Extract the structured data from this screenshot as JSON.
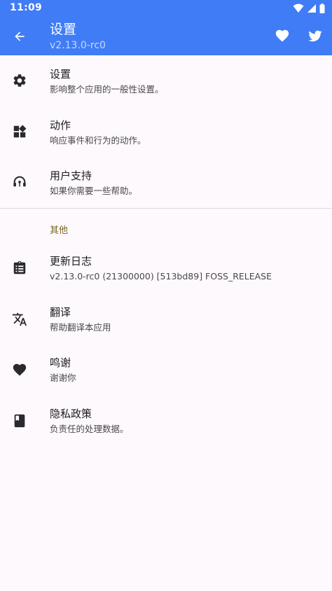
{
  "status_bar": {
    "time": "11:09"
  },
  "app_bar": {
    "title": "设置",
    "subtitle": "v2.13.0-rc0",
    "actions": [
      "heart-icon",
      "twitter-icon"
    ],
    "background_color": "#3f7cf6"
  },
  "items": [
    {
      "icon": "gear-icon",
      "title": "设置",
      "summary": "影响整个应用的一般性设置。"
    },
    {
      "icon": "widgets-icon",
      "title": "动作",
      "summary": "响应事件和行为的动作。"
    },
    {
      "icon": "support-headset-icon",
      "title": "用户支持",
      "summary": "如果你需要一些帮助。"
    }
  ],
  "other": {
    "header": "其他",
    "header_color": "#7a6420",
    "items": [
      {
        "icon": "changelog-clipboard-icon",
        "title": "更新日志",
        "summary": "v2.13.0-rc0 (21300000) [513bd89] FOSS_RELEASE"
      },
      {
        "icon": "translate-icon",
        "title": "翻译",
        "summary": "帮助翻译本应用"
      },
      {
        "icon": "heart-icon",
        "title": "鸣谢",
        "summary": "谢谢你"
      },
      {
        "icon": "book-icon",
        "title": "隐私政策",
        "summary": "负责任的处理数据。"
      }
    ]
  }
}
